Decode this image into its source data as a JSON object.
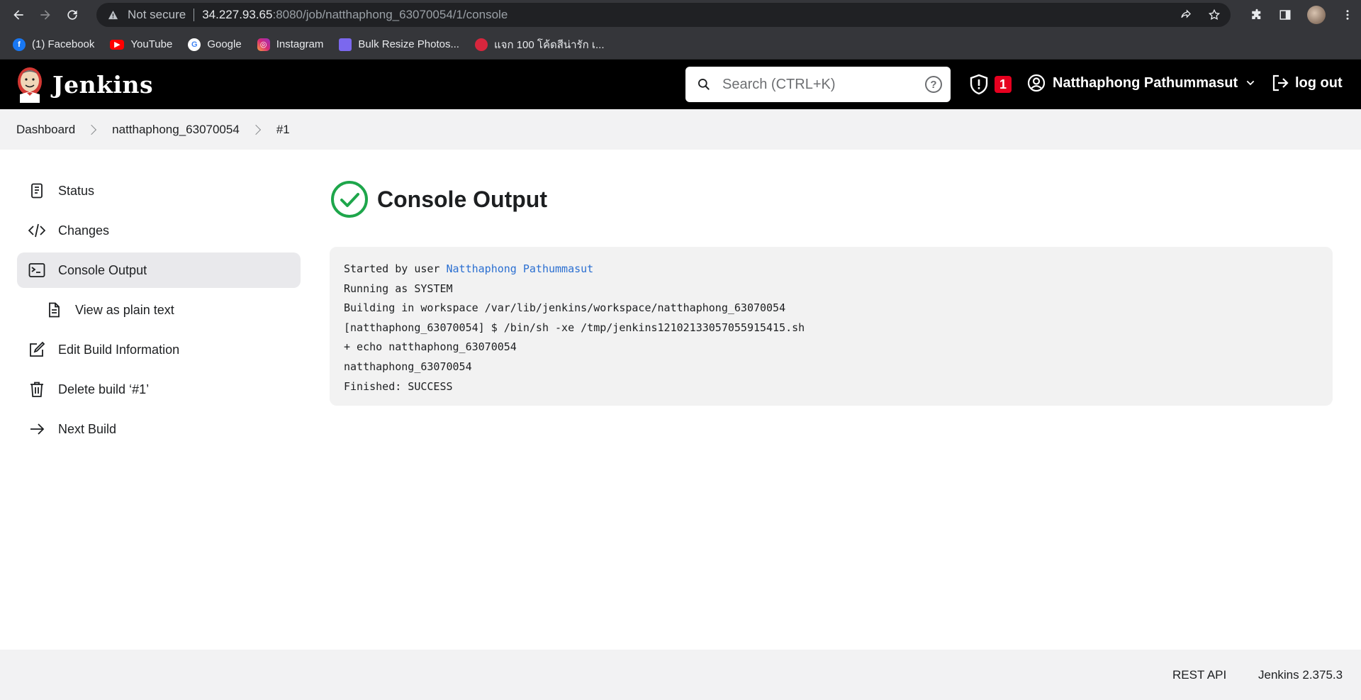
{
  "browser": {
    "security_label": "Not secure",
    "url_host": "34.227.93.65",
    "url_path": ":8080/job/natthaphong_63070054/1/console",
    "bookmarks": [
      {
        "label": "(1) Facebook",
        "icon": "facebook-icon"
      },
      {
        "label": "YouTube",
        "icon": "youtube-icon"
      },
      {
        "label": "Google",
        "icon": "google-icon"
      },
      {
        "label": "Instagram",
        "icon": "instagram-icon"
      },
      {
        "label": "Bulk Resize Photos...",
        "icon": "bulk-resize-icon"
      },
      {
        "label": "แจก 100 โค้ดสีน่ารัก เ...",
        "icon": "red-bookmark-icon"
      }
    ]
  },
  "header": {
    "app_name": "Jenkins",
    "search_placeholder": "Search (CTRL+K)",
    "help_glyph": "?",
    "security_count": "1",
    "user_name": "Natthaphong Pathummasut",
    "logout_label": "log out"
  },
  "breadcrumb": {
    "items": [
      "Dashboard",
      "natthaphong_63070054",
      "#1"
    ]
  },
  "sidebar": {
    "items": [
      {
        "label": "Status",
        "icon": "status-document-icon"
      },
      {
        "label": "Changes",
        "icon": "code-changes-icon"
      },
      {
        "label": "Console Output",
        "icon": "terminal-icon",
        "active": true
      },
      {
        "label": "View as plain text",
        "icon": "plain-text-document-icon"
      },
      {
        "label": "Edit Build Information",
        "icon": "edit-icon"
      },
      {
        "label": "Delete build ‘#1’",
        "icon": "trash-icon"
      },
      {
        "label": "Next Build",
        "icon": "arrow-right-icon"
      }
    ]
  },
  "main": {
    "title": "Console Output",
    "status": "success",
    "console": {
      "started_prefix": "Started by user ",
      "started_user": "Natthaphong Pathummasut",
      "lines": [
        "Running as SYSTEM",
        "Building in workspace /var/lib/jenkins/workspace/natthaphong_63070054",
        "[natthaphong_63070054] $ /bin/sh -xe /tmp/jenkins12102133057055915415.sh",
        "+ echo natthaphong_63070054",
        "natthaphong_63070054",
        "Finished: SUCCESS"
      ]
    }
  },
  "footer": {
    "rest_api": "REST API",
    "version": "Jenkins 2.375.3"
  },
  "colors": {
    "header_bg": "#000000",
    "success_green": "#1ea64b",
    "link_blue": "#2b6fd1",
    "badge_red": "#e6001f"
  }
}
